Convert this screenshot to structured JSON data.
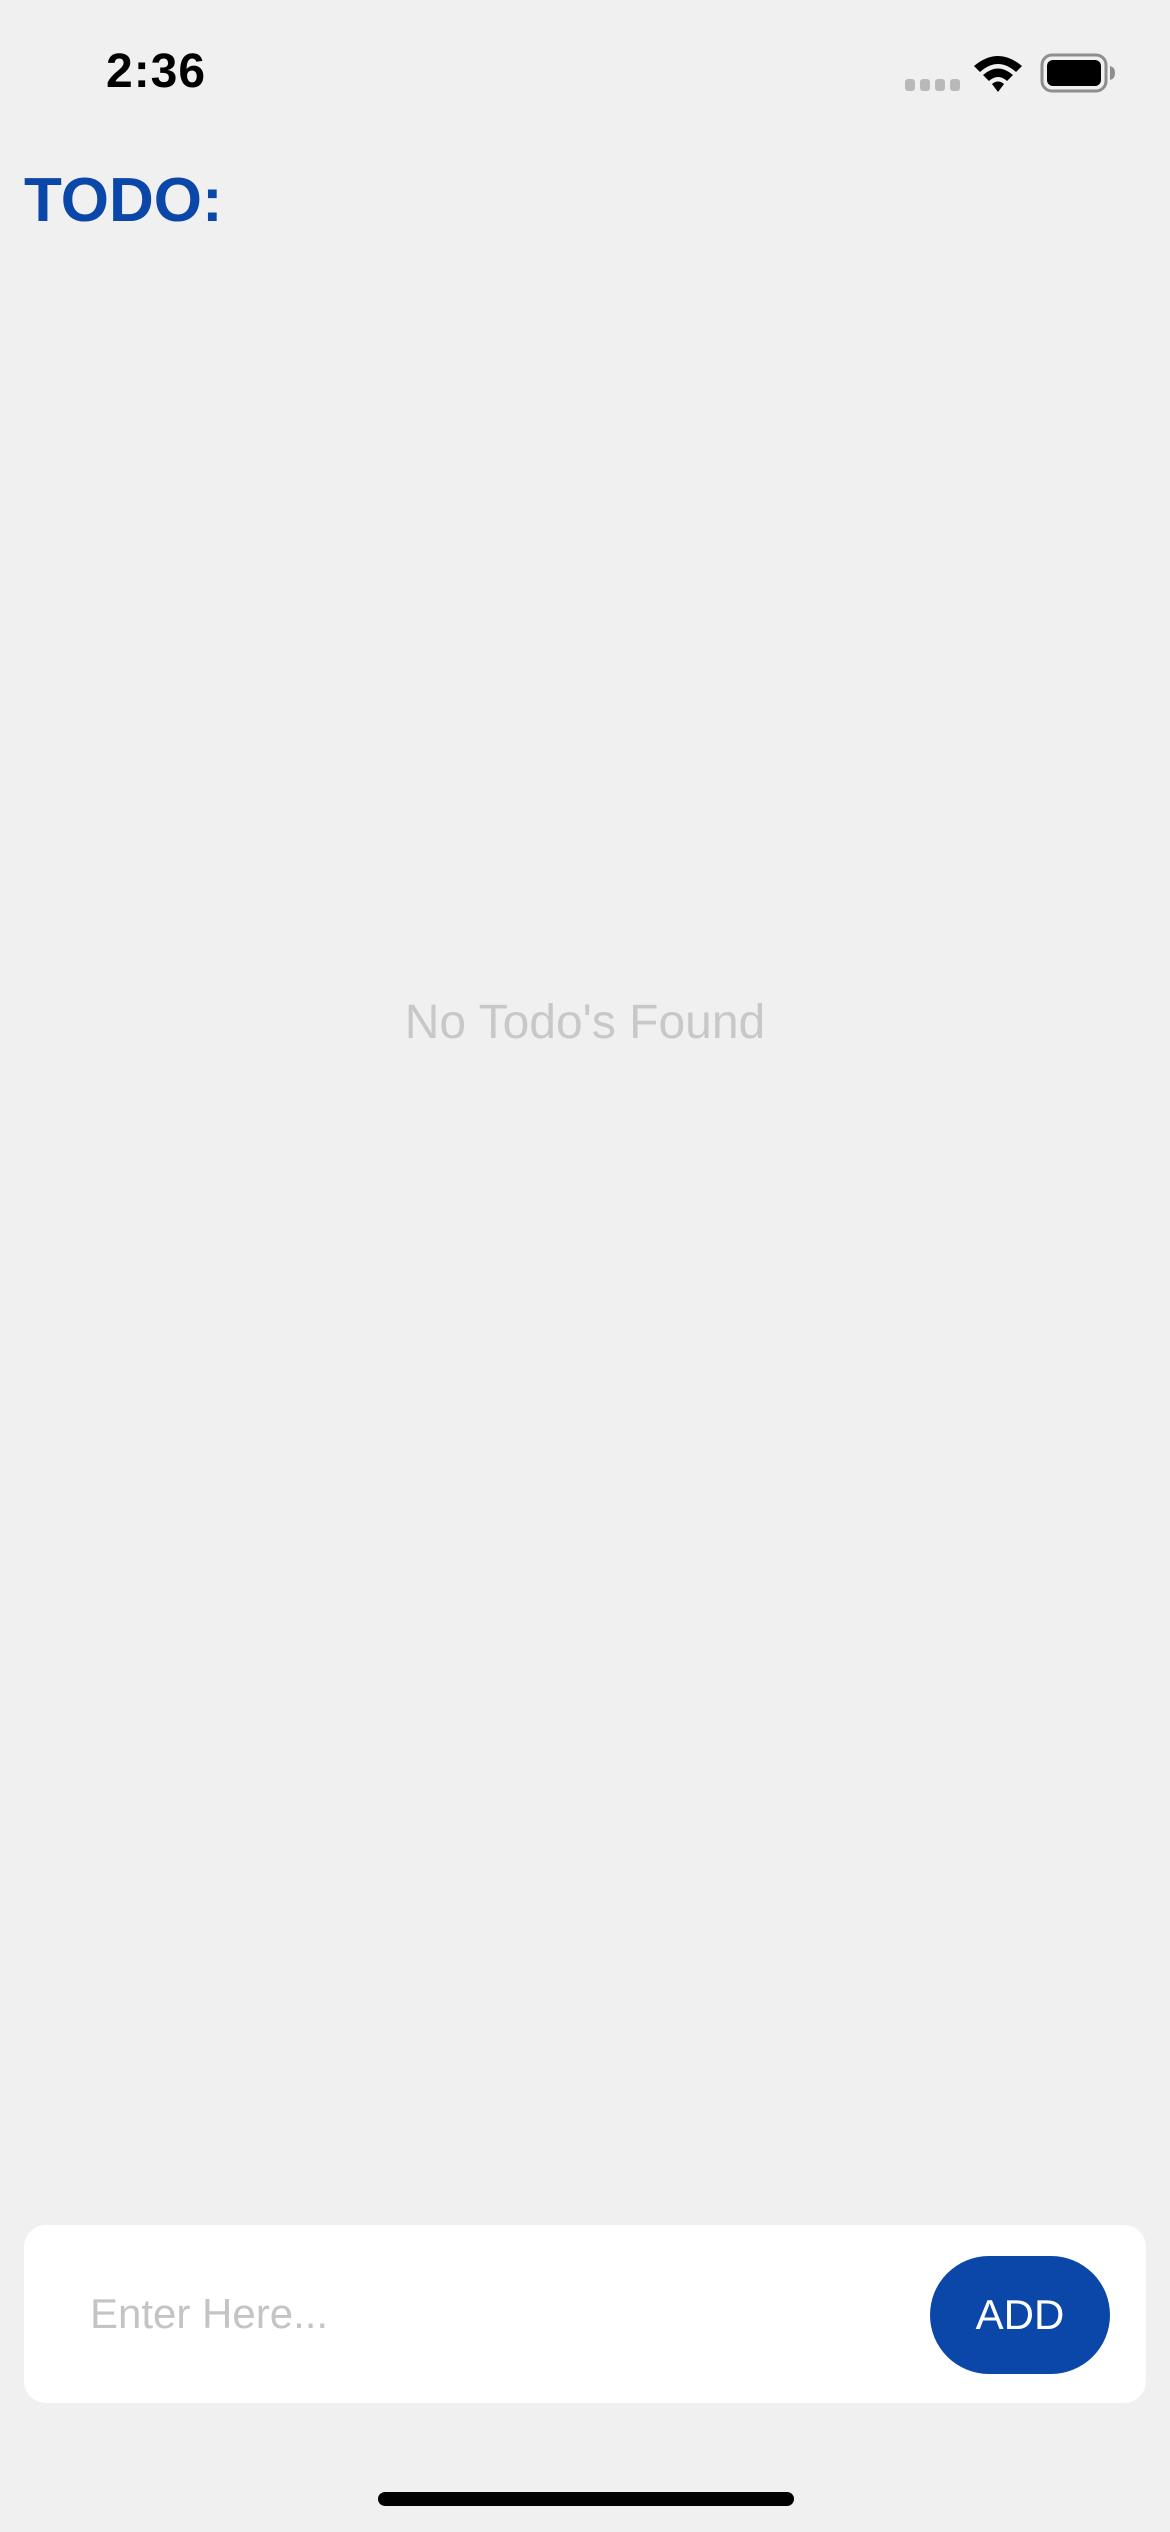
{
  "status_bar": {
    "time": "2:36",
    "icons": [
      "signal-icon",
      "wifi-icon",
      "battery-icon"
    ]
  },
  "header": {
    "title": "TODO:"
  },
  "main": {
    "empty_message": "No Todo's Found"
  },
  "input": {
    "placeholder": "Enter Here...",
    "value": "",
    "add_label": "ADD"
  },
  "colors": {
    "accent": "#0a47a9",
    "background": "#f0f0f0",
    "panel": "#ffffff",
    "muted_text": "#c8c8c8"
  }
}
